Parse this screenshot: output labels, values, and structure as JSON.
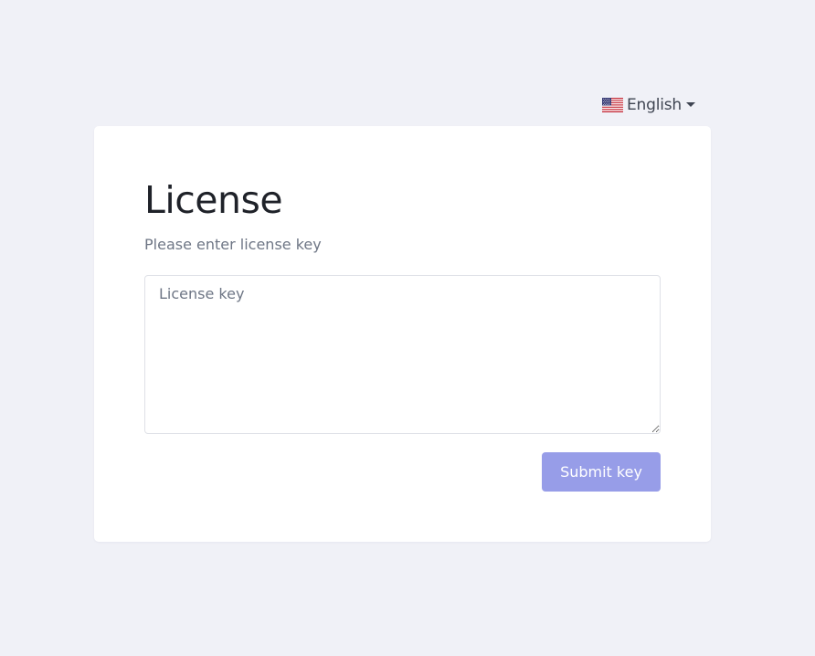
{
  "language_switcher": {
    "label": "English",
    "flag_icon": "us-flag-icon",
    "caret_icon": "caret-down-icon"
  },
  "license_card": {
    "title": "License",
    "subtitle": "Please enter license key",
    "input_placeholder": "License key",
    "input_value": "",
    "submit_label": "Submit key"
  },
  "colors": {
    "page_background": "#f0f1f7",
    "card_background": "#ffffff",
    "submit_button": "#979de8"
  }
}
